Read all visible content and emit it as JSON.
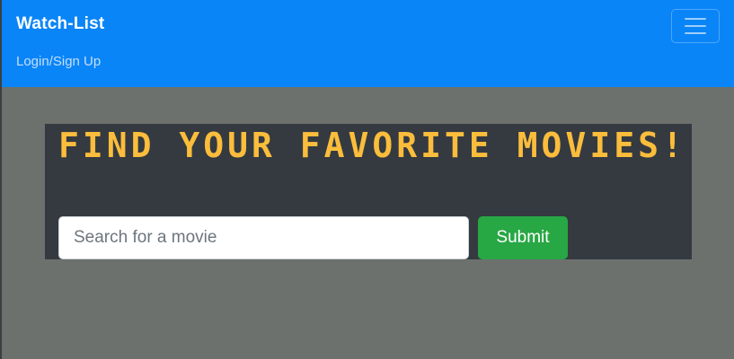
{
  "navbar": {
    "brand": "Watch-List",
    "link": "Login/Sign Up",
    "toggler_icon": "hamburger-menu-icon",
    "background": "#0a85f7"
  },
  "hero": {
    "title": "Find Your Favorite Movies!",
    "title_color": "#fbbd3b",
    "background": "#343a40"
  },
  "search": {
    "placeholder": "Search for a movie",
    "value": "",
    "submit_label": "Submit",
    "submit_color": "#28a745"
  },
  "page": {
    "background": "#6c716e"
  }
}
